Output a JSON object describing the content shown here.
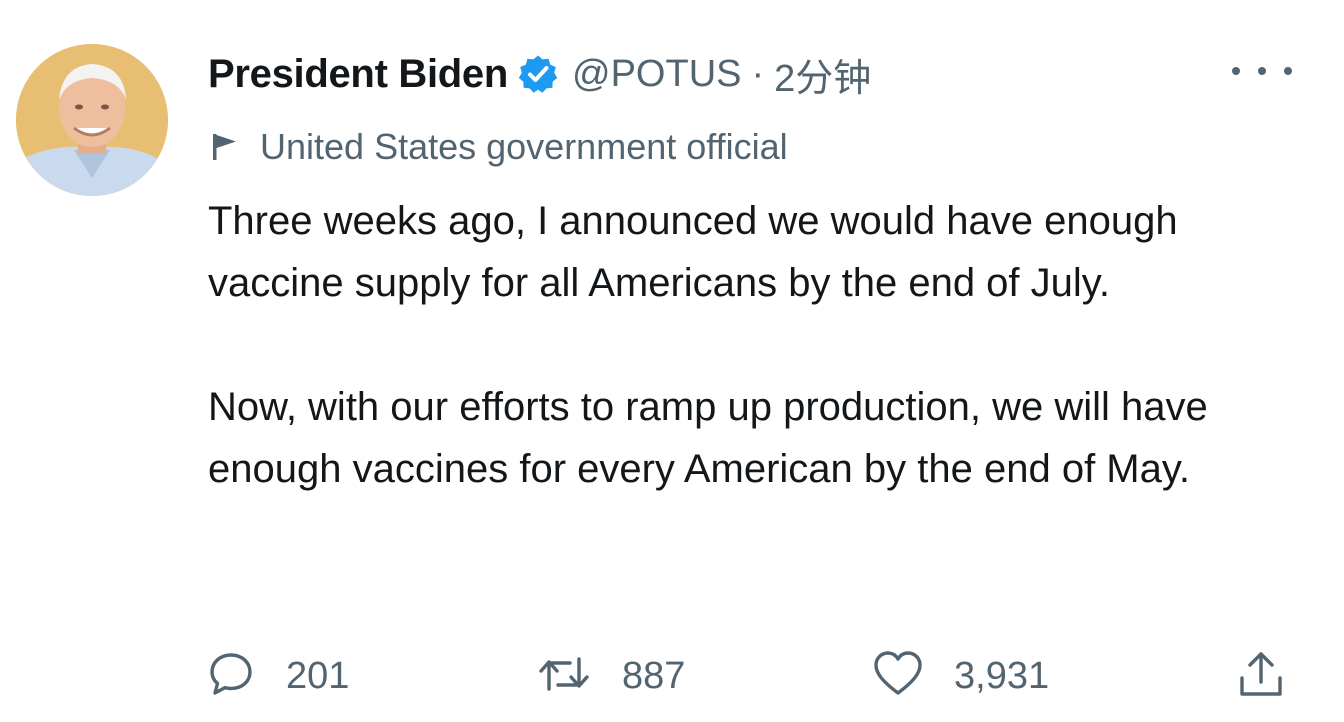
{
  "tweet": {
    "display_name": "President Biden",
    "handle": "@POTUS",
    "separator": "·",
    "time": "2分钟",
    "label": "United States government official",
    "paragraphs": [
      "Three weeks ago, I announced we would have enough vaccine supply for all Americans by the end of July.",
      "Now, with our efforts to ramp up production, we will have enough vaccines for every American by the end of May."
    ],
    "icons": {
      "verified": "verified-badge-icon",
      "label": "flag-icon",
      "more": "more-dots-icon",
      "reply": "reply-bubble-icon",
      "retweet": "retweet-icon",
      "like": "heart-icon",
      "share": "share-icon"
    },
    "actions": {
      "reply_count": "201",
      "retweet_count": "887",
      "like_count": "3,931"
    },
    "colors": {
      "verified_blue": "#1d9bf0",
      "secondary_text": "#536471",
      "primary_text": "#14171a",
      "avatar_background": "#e8bf72"
    }
  }
}
